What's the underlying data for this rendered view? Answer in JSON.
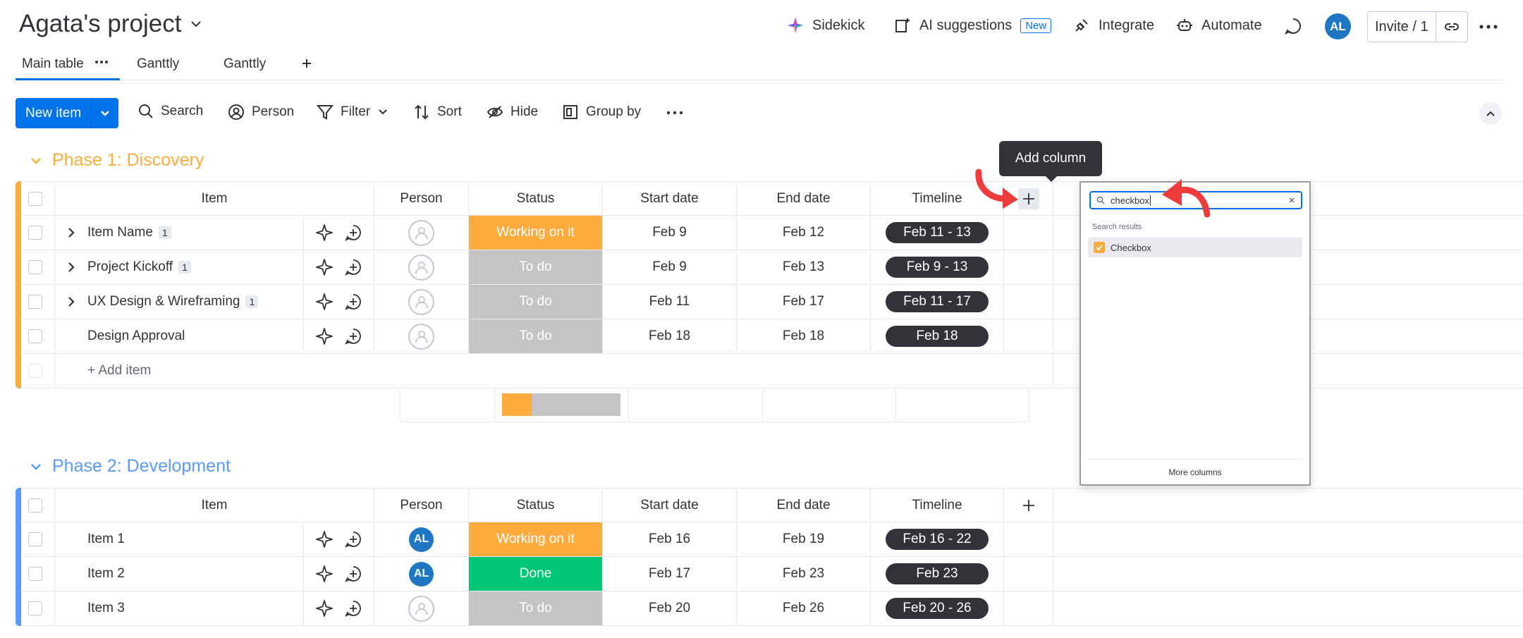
{
  "header": {
    "title": "Agata's project",
    "sidekick": "Sidekick",
    "ai_suggestions": "AI suggestions",
    "new_tag": "New",
    "integrate": "Integrate",
    "automate": "Automate",
    "avatar_initials": "AL",
    "invite": "Invite / 1"
  },
  "tabs": [
    "Main table",
    "Ganttly",
    "Ganttly"
  ],
  "toolbar": {
    "new_item": "New item",
    "search": "Search",
    "person": "Person",
    "filter": "Filter",
    "sort": "Sort",
    "hide": "Hide",
    "group_by": "Group by"
  },
  "columns": [
    "Item",
    "Person",
    "Status",
    "Start date",
    "End date",
    "Timeline"
  ],
  "groups": [
    {
      "title": "Phase 1: Discovery",
      "color": "#fdab3d",
      "add_item": "+ Add item",
      "rows": [
        {
          "item": "Item Name",
          "subitems": "1",
          "person": "",
          "status": "Working on it",
          "status_color": "#fdab3d",
          "start": "Feb 9",
          "end": "Feb 12",
          "timeline": "Feb 11 - 13"
        },
        {
          "item": "Project Kickoff",
          "subitems": "1",
          "person": "",
          "status": "To do",
          "status_color": "#c4c4c4",
          "start": "Feb 9",
          "end": "Feb 13",
          "timeline": "Feb 9 - 13"
        },
        {
          "item": "UX Design & Wireframing",
          "subitems": "1",
          "person": "",
          "status": "To do",
          "status_color": "#c4c4c4",
          "start": "Feb 11",
          "end": "Feb 17",
          "timeline": "Feb 11 - 17"
        },
        {
          "item": "Design Approval",
          "subitems": "",
          "person": "",
          "status": "To do",
          "status_color": "#c4c4c4",
          "start": "Feb 18",
          "end": "Feb 18",
          "timeline": "Feb 18"
        }
      ]
    },
    {
      "title": "Phase 2: Development",
      "color": "#579bfc",
      "rows": [
        {
          "item": "Item 1",
          "person": "AL",
          "status": "Working on it",
          "status_color": "#fdab3d",
          "start": "Feb 16",
          "end": "Feb 19",
          "timeline": "Feb 16 - 22"
        },
        {
          "item": "Item 2",
          "person": "AL",
          "status": "Done",
          "status_color": "#00c875",
          "start": "Feb 17",
          "end": "Feb 23",
          "timeline": "Feb 23"
        },
        {
          "item": "Item 3",
          "person": "",
          "status": "To do",
          "status_color": "#c4c4c4",
          "start": "Feb 20",
          "end": "Feb 26",
          "timeline": "Feb 20 - 26"
        }
      ]
    }
  ],
  "tooltip": "Add column",
  "popup": {
    "search_value": "checkbox",
    "results_label": "Search results",
    "result": "Checkbox",
    "more_columns": "More columns"
  }
}
